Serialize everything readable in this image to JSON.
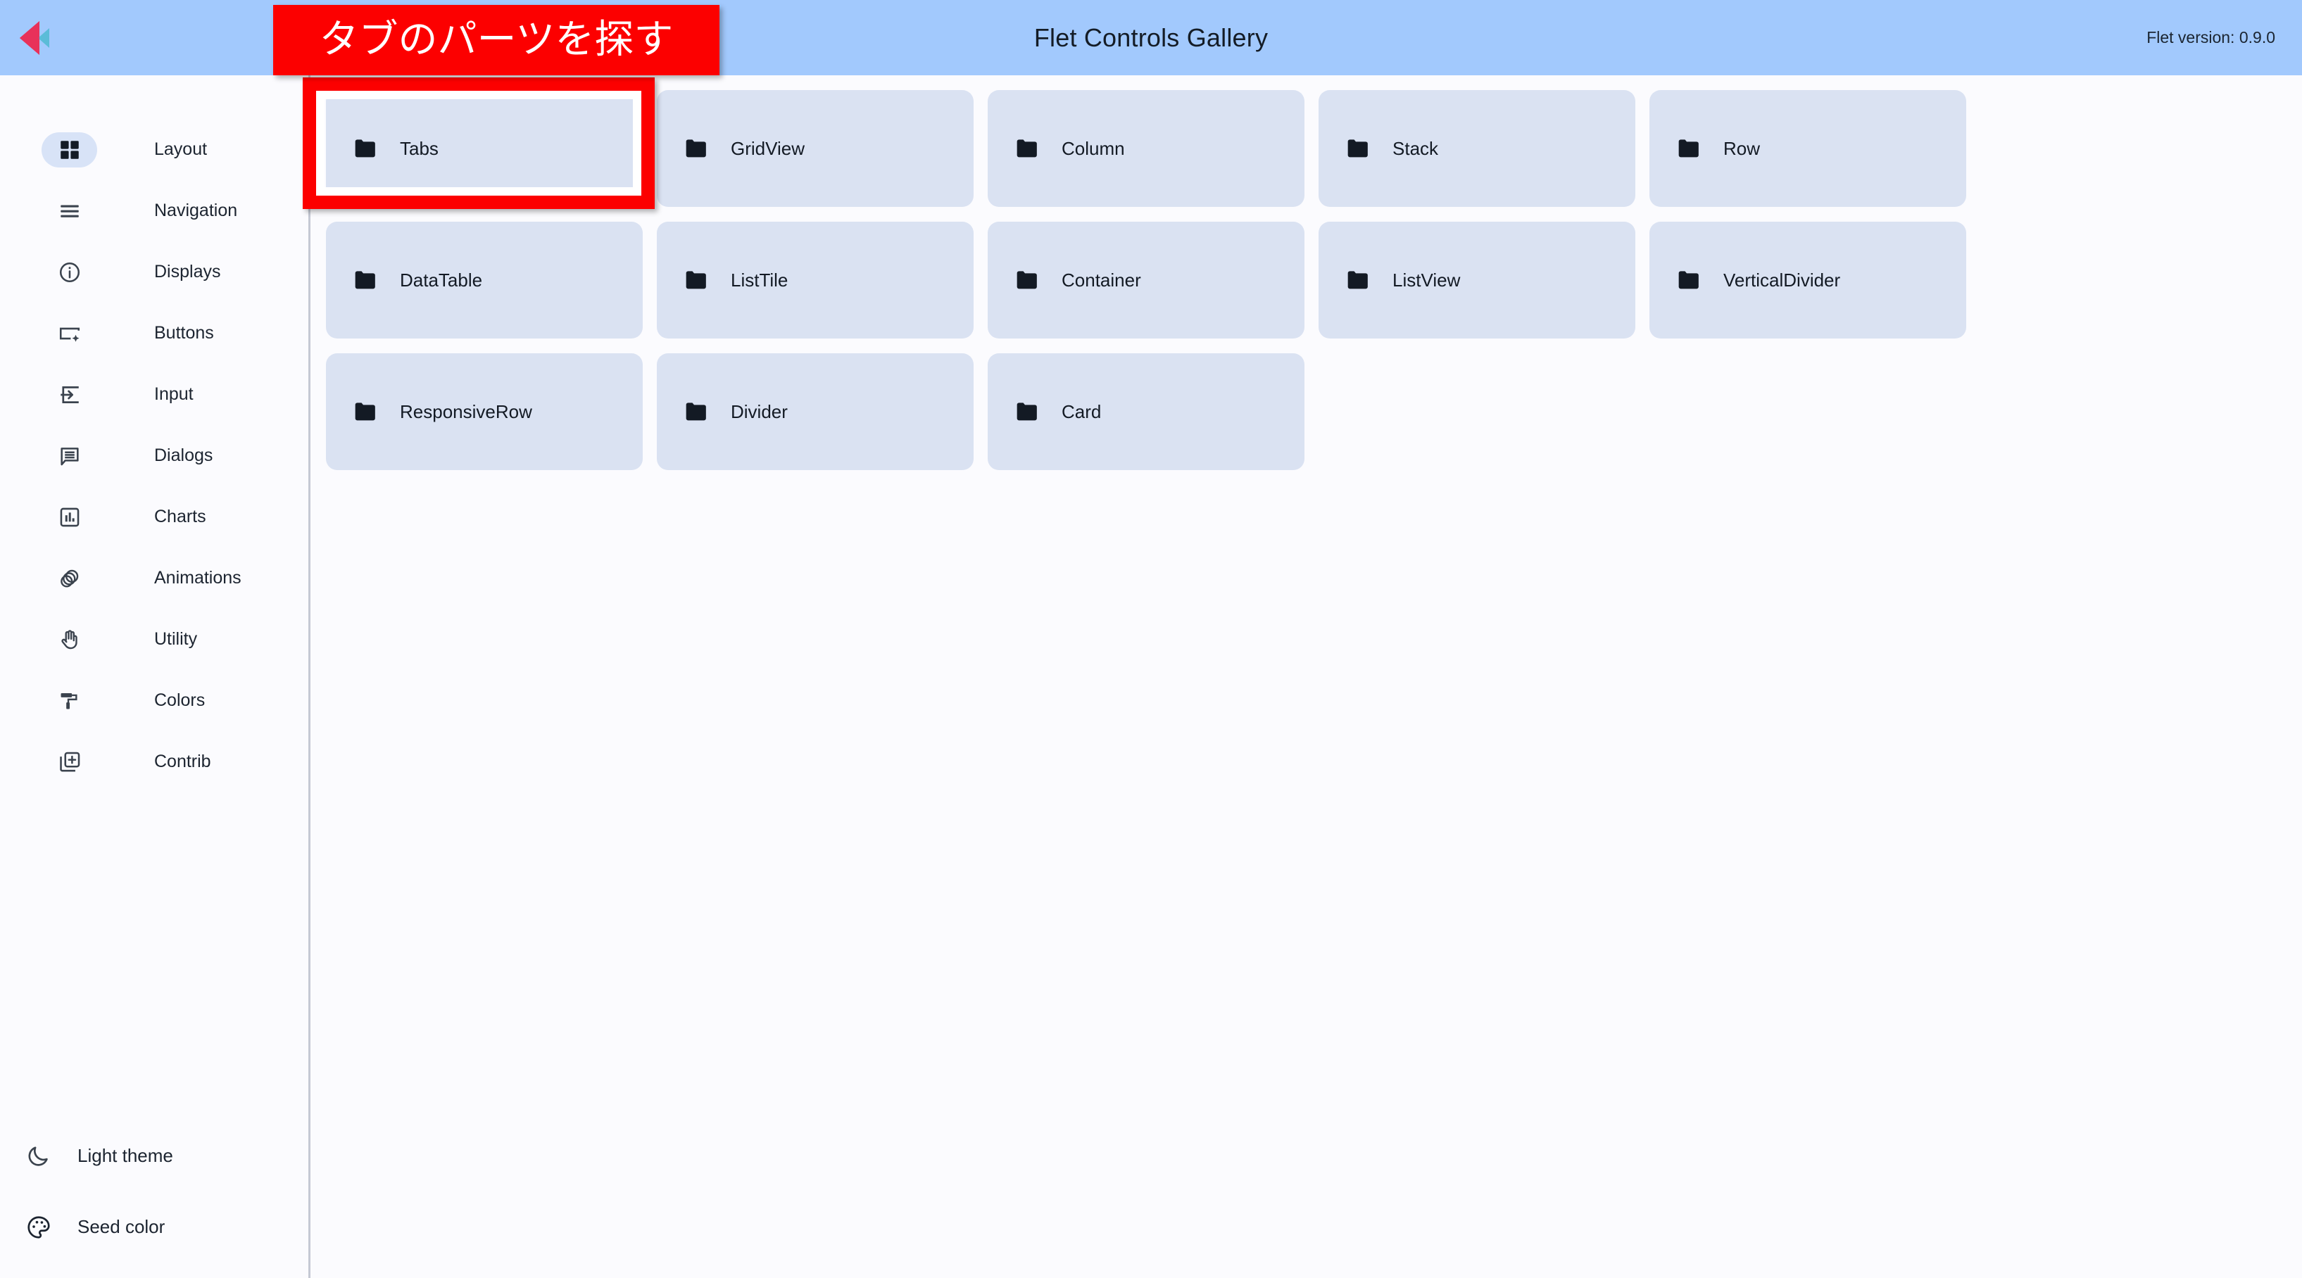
{
  "header": {
    "logo_icon": "flet-logo-icon",
    "title": "Flet Controls Gallery",
    "version": "Flet version: 0.9.0",
    "background_color": "#a2c9fd"
  },
  "annotation": {
    "label_text": "タブのパーツを探す",
    "label_color": "#fc0000",
    "label_text_color": "#ffffff",
    "highlight_target": "Tabs"
  },
  "sidebar": {
    "items": [
      {
        "label": "Layout",
        "icon": "grid-view-icon",
        "selected": true
      },
      {
        "label": "Navigation",
        "icon": "menu-icon",
        "selected": false
      },
      {
        "label": "Displays",
        "icon": "info-circle-icon",
        "selected": false
      },
      {
        "label": "Buttons",
        "icon": "smart-button-icon",
        "selected": false
      },
      {
        "label": "Input",
        "icon": "input-icon",
        "selected": false
      },
      {
        "label": "Dialogs",
        "icon": "chat-bubble-icon",
        "selected": false
      },
      {
        "label": "Charts",
        "icon": "bar-chart-icon",
        "selected": false
      },
      {
        "label": "Animations",
        "icon": "animation-icon",
        "selected": false
      },
      {
        "label": "Utility",
        "icon": "pan-tool-icon",
        "selected": false
      },
      {
        "label": "Colors",
        "icon": "format-paint-icon",
        "selected": false
      },
      {
        "label": "Contrib",
        "icon": "library-add-icon",
        "selected": false
      }
    ],
    "bottom_actions": [
      {
        "label": "Light theme",
        "icon": "moon-icon"
      },
      {
        "label": "Seed color",
        "icon": "palette-icon"
      }
    ]
  },
  "main": {
    "card_icon": "folder-icon",
    "card_color": "#dae2f2",
    "cards": [
      {
        "label": "Tabs"
      },
      {
        "label": "GridView"
      },
      {
        "label": "Column"
      },
      {
        "label": "Stack"
      },
      {
        "label": "Row"
      },
      {
        "label": "DataTable"
      },
      {
        "label": "ListTile"
      },
      {
        "label": "Container"
      },
      {
        "label": "ListView"
      },
      {
        "label": "VerticalDivider"
      },
      {
        "label": "ResponsiveRow"
      },
      {
        "label": "Divider"
      },
      {
        "label": "Card"
      }
    ]
  }
}
